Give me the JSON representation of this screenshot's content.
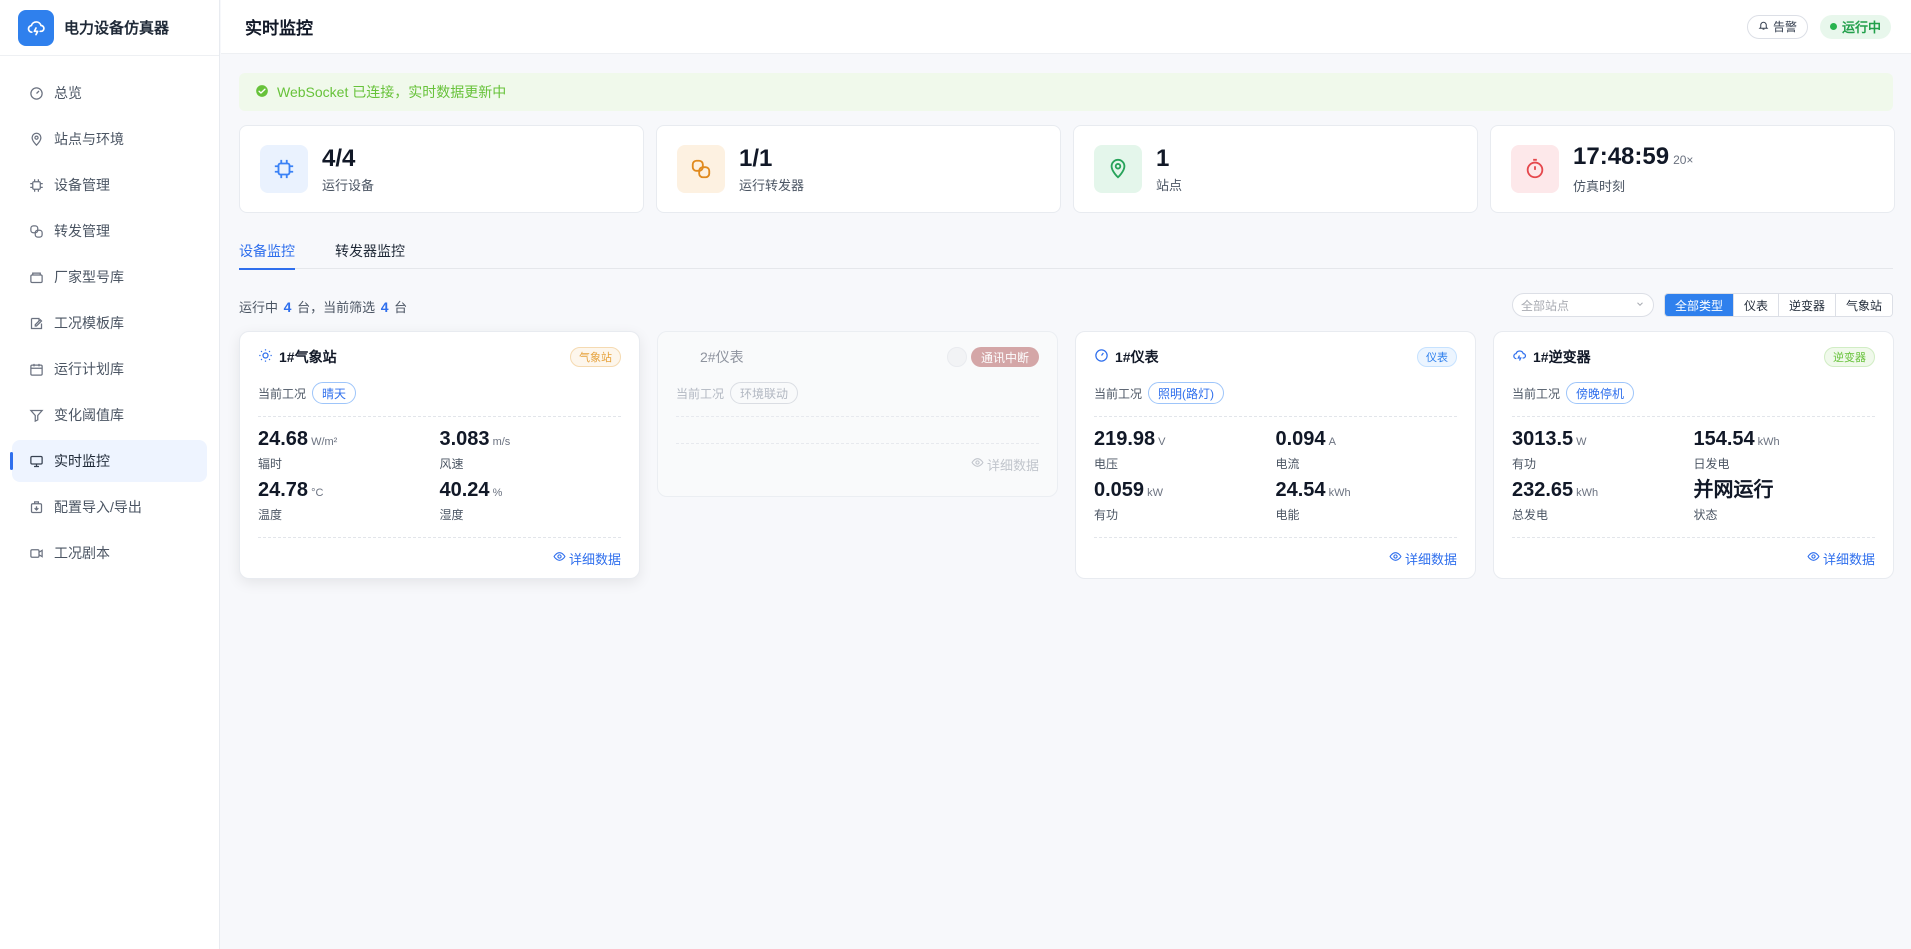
{
  "app": {
    "name": "电力设备仿真器"
  },
  "sidebar": {
    "items": [
      {
        "label": "总览",
        "icon": "dashboard-gauge-icon"
      },
      {
        "label": "站点与环境",
        "icon": "map-pin-icon"
      },
      {
        "label": "设备管理",
        "icon": "chip-icon"
      },
      {
        "label": "转发管理",
        "icon": "link-icon"
      },
      {
        "label": "厂家型号库",
        "icon": "package-icon"
      },
      {
        "label": "工况模板库",
        "icon": "edit-template-icon"
      },
      {
        "label": "运行计划库",
        "icon": "calendar-icon"
      },
      {
        "label": "变化阈值库",
        "icon": "filter-icon"
      },
      {
        "label": "实时监控",
        "icon": "monitor-icon",
        "active": true
      },
      {
        "label": "配置导入/导出",
        "icon": "import-export-icon"
      },
      {
        "label": "工况剧本",
        "icon": "video-icon"
      }
    ]
  },
  "header": {
    "title": "实时监控",
    "alarm_label": "告警",
    "status_label": "运行中"
  },
  "banner": {
    "text": "WebSocket 已连接，实时数据更新中"
  },
  "stats": [
    {
      "value": "4/4",
      "label": "运行设备",
      "icon": "chip-icon",
      "color": "#3b82f6",
      "bg": "#eaf2fe"
    },
    {
      "value": "1/1",
      "label": "运行转发器",
      "icon": "link-icon",
      "color": "#e08a1e",
      "bg": "#fdf1e1"
    },
    {
      "value": "1",
      "label": "站点",
      "icon": "map-pin-icon",
      "color": "#27a35a",
      "bg": "#e4f6eb"
    },
    {
      "value": "17:48:59",
      "suffix": "20×",
      "label": "仿真时刻",
      "icon": "stopwatch-icon",
      "color": "#e5484d",
      "bg": "#fde8ea"
    }
  ],
  "tabs": [
    {
      "label": "设备监控",
      "active": true
    },
    {
      "label": "转发器监控",
      "active": false
    }
  ],
  "summary": {
    "prefix": "运行中",
    "running": "4",
    "middle": "台，当前筛选",
    "filtered": "4",
    "suffix": "台"
  },
  "filters": {
    "site_placeholder": "全部站点",
    "types": [
      {
        "label": "全部类型",
        "active": true
      },
      {
        "label": "仪表",
        "active": false
      },
      {
        "label": "逆变器",
        "active": false
      },
      {
        "label": "气象站",
        "active": false
      }
    ]
  },
  "devices": [
    {
      "name": "1#气象站",
      "icon": "sun-icon",
      "type_tag": "气象站",
      "condition_label": "当前工况",
      "condition": "晴天",
      "metrics": [
        {
          "value": "24.68",
          "unit": "W/m²",
          "label": "辐时"
        },
        {
          "value": "3.083",
          "unit": "m/s",
          "label": "风速"
        },
        {
          "value": "24.78",
          "unit": "°C",
          "label": "温度"
        },
        {
          "value": "40.24",
          "unit": "%",
          "label": "湿度"
        }
      ],
      "detail_label": "详细数据"
    },
    {
      "name": "2#仪表",
      "status_tag": "通讯中断",
      "condition_label": "当前工况",
      "condition": "环境联动",
      "detail_label": "详细数据"
    },
    {
      "name": "1#仪表",
      "icon": "gauge-icon",
      "type_tag": "仪表",
      "condition_label": "当前工况",
      "condition": "照明(路灯)",
      "metrics": [
        {
          "value": "219.98",
          "unit": "V",
          "label": "电压"
        },
        {
          "value": "0.094",
          "unit": "A",
          "label": "电流"
        },
        {
          "value": "0.059",
          "unit": "kW",
          "label": "有功"
        },
        {
          "value": "24.54",
          "unit": "kWh",
          "label": "电能"
        }
      ],
      "detail_label": "详细数据"
    },
    {
      "name": "1#逆变器",
      "icon": "cloud-bolt-icon",
      "type_tag": "逆变器",
      "condition_label": "当前工况",
      "condition": "傍晚停机",
      "metrics": [
        {
          "value": "3013.5",
          "unit": "W",
          "label": "有功"
        },
        {
          "value": "154.54",
          "unit": "kWh",
          "label": "日发电"
        },
        {
          "value": "232.65",
          "unit": "kWh",
          "label": "总发电"
        },
        {
          "value": "并网运行",
          "unit": "",
          "label": "状态"
        }
      ],
      "detail_label": "详细数据"
    }
  ]
}
